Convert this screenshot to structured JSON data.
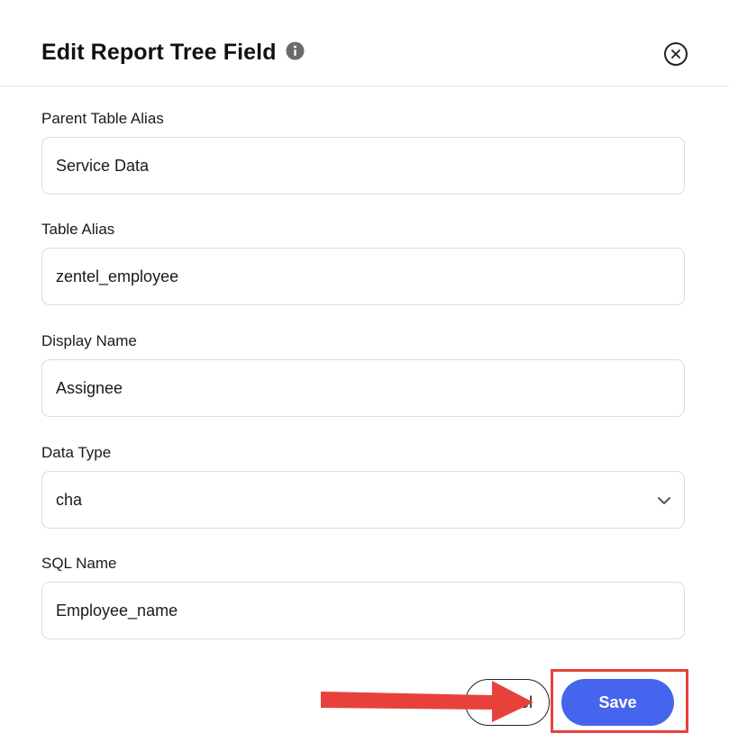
{
  "dialog": {
    "title": "Edit Report Tree Field",
    "icons": {
      "info": "info-icon",
      "close": "close-icon",
      "chevron": "chevron-down-icon"
    }
  },
  "fields": {
    "parent_table_alias": {
      "label": "Parent Table Alias",
      "value": "Service Data"
    },
    "table_alias": {
      "label": "Table Alias",
      "value": "zentel_employee"
    },
    "display_name": {
      "label": "Display Name",
      "value": "Assignee"
    },
    "data_type": {
      "label": "Data Type",
      "value": "cha"
    },
    "sql_name": {
      "label": "SQL Name",
      "value": "Employee_name"
    }
  },
  "footer": {
    "cancel_label": "Cancel",
    "save_label": "Save"
  },
  "annotation": {
    "color": "#e8413b",
    "accent": "#4565ee"
  }
}
